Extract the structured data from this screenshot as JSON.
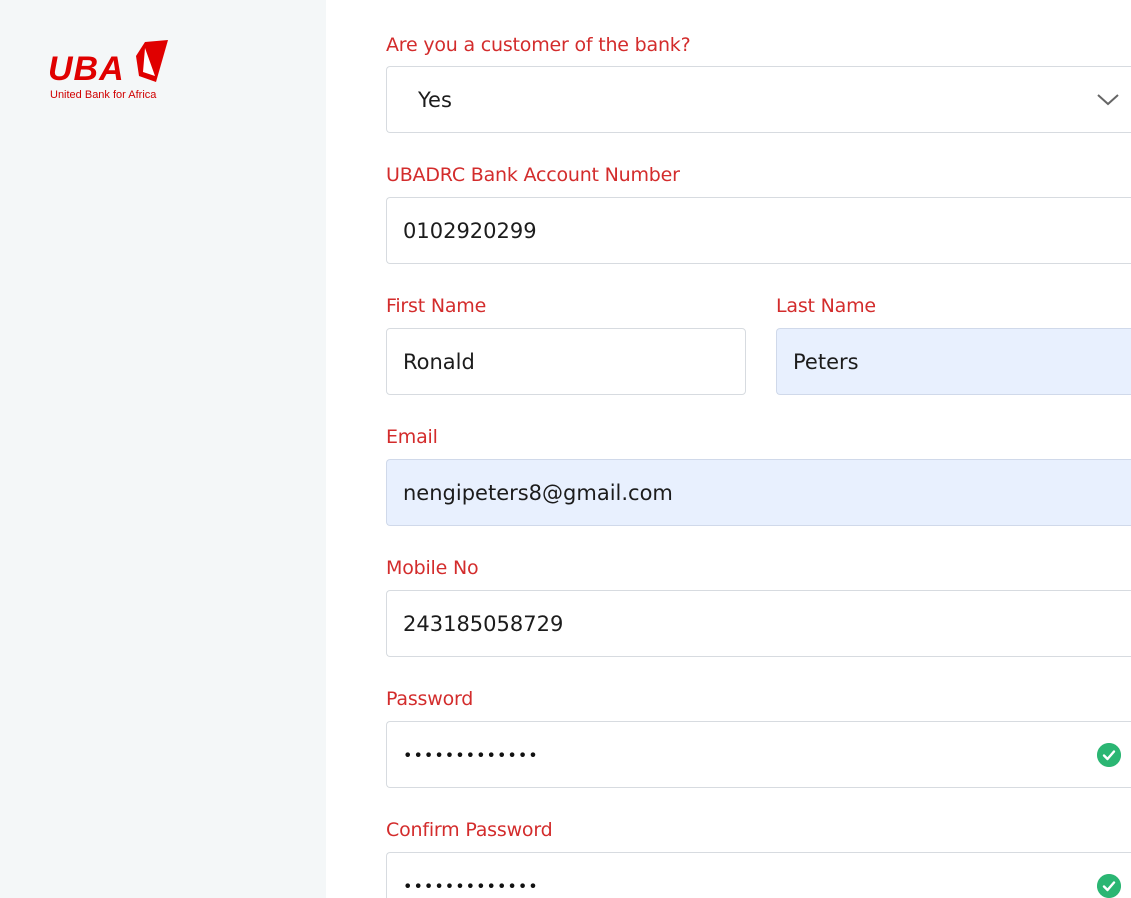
{
  "brand": {
    "name": "UBA",
    "tagline": "United Bank for Africa",
    "color": "#e00000"
  },
  "form": {
    "customer": {
      "label": "Are you a customer of the bank?",
      "selected": "Yes",
      "icon": "chevron-down-icon"
    },
    "account_number": {
      "label": "UBADRC Bank Account Number",
      "value": "0102920299"
    },
    "first_name": {
      "label": "First Name",
      "value": "Ronald"
    },
    "last_name": {
      "label": "Last Name",
      "value": "Peters"
    },
    "email": {
      "label": "Email",
      "value": "nengipeters8@gmail.com"
    },
    "mobile": {
      "label": "Mobile No",
      "value": "243185058729"
    },
    "password": {
      "label": "Password",
      "value": "•••••••••••••",
      "status_icon": "check-circle-icon"
    },
    "confirm_password": {
      "label": "Confirm Password",
      "value": "•••••••••••••",
      "status_icon": "check-circle-icon"
    }
  },
  "colors": {
    "label": "#d32c2c",
    "autofill": "#e8f0fe",
    "valid": "#2bb673"
  }
}
